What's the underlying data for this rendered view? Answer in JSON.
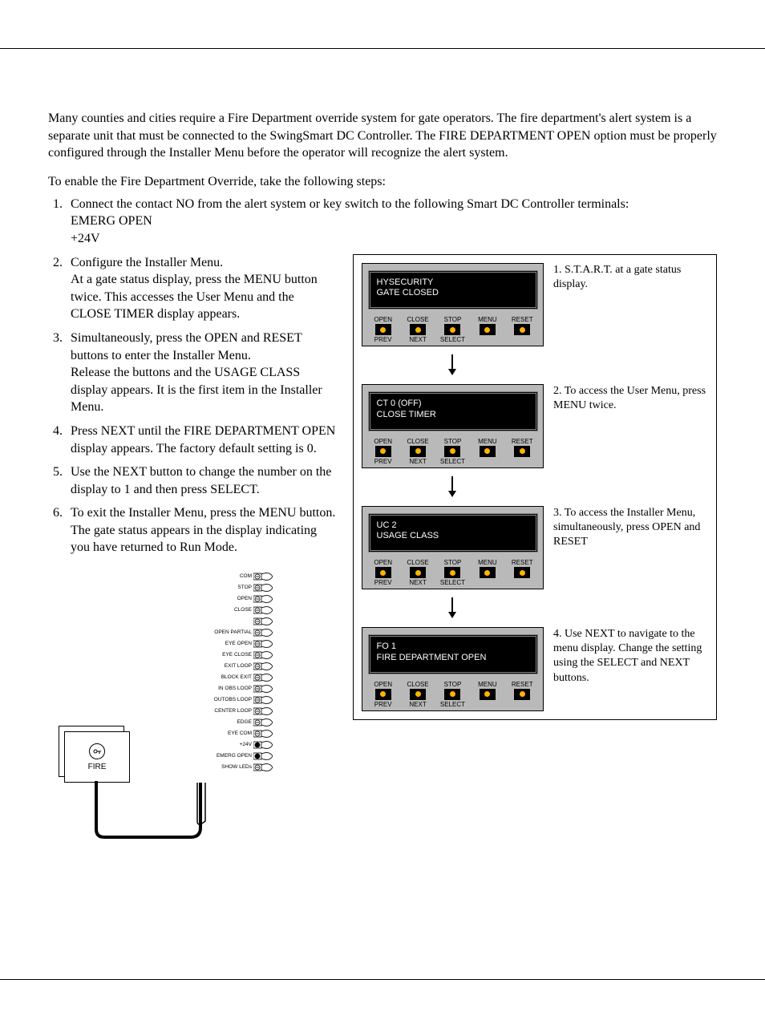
{
  "intro": "Many counties and cities require a Fire Department override system for gate operators. The fire department's alert system is a separate unit that must be connected to the SwingSmart DC Controller. The FIRE DEPARTMENT OPEN option must be properly configured through the Installer Menu before the operator will recognize the alert system.",
  "enable_line": "To enable the Fire Department Override, take the following steps:",
  "steps_top": [
    "Connect the contact NO from the alert system or key switch to the following Smart DC Controller terminals:\nEMERG OPEN\n+24V"
  ],
  "steps_left": [
    "Configure the Installer Menu.\nAt a gate status display, press the MENU button twice. This accesses the User Menu and the CLOSE TIMER display appears.",
    "Simultaneously, press the OPEN and RESET buttons to enter the Installer Menu.\nRelease the buttons and the USAGE CLASS display appears. It is the first item in the Installer Menu.",
    "Press NEXT until the FIRE DEPARTMENT OPEN display appears. The factory default setting is 0.",
    "Use the NEXT button to change the number on the display to 1 and then press SELECT.",
    "To exit the Installer Menu, press the MENU button. The gate status appears in the display indicating you have returned to Run Mode."
  ],
  "panel_buttons": {
    "top": [
      "OPEN",
      "CLOSE",
      "STOP",
      "MENU",
      "RESET"
    ],
    "bottom": [
      "PREV",
      "NEXT",
      "SELECT",
      "",
      ""
    ]
  },
  "panels": [
    {
      "line1": "HYSECURITY",
      "line2": "GATE CLOSED",
      "desc": "1. S.T.A.R.T. at a gate status display."
    },
    {
      "line1": "CT  0   (OFF)",
      "line2": "CLOSE TIMER",
      "desc": "2. To access the User Menu, press MENU twice."
    },
    {
      "line1": "UC  2",
      "line2": "USAGE CLASS",
      "desc": "3. To access the Installer Menu, simultaneously, press OPEN and RESET"
    },
    {
      "line1": "FO  1",
      "line2": "FIRE DEPARTMENT OPEN",
      "desc": "4. Use NEXT to navigate to the menu display. Change the setting using the SELECT and NEXT buttons."
    }
  ],
  "fire_label": "FIRE",
  "terminals": [
    "COM",
    "STOP",
    "OPEN",
    "CLOSE",
    "",
    "OPEN PARTIAL",
    "EYE OPEN",
    "EYE CLOSE",
    "EXIT LOOP",
    "BLOCK EXIT",
    "IN OBS LOOP",
    "OUTOBS LOOP",
    "CENTER LOOP",
    "EDGE",
    "EYE COM",
    "+24V",
    "EMERG OPEN",
    "SHOW LEDs"
  ]
}
